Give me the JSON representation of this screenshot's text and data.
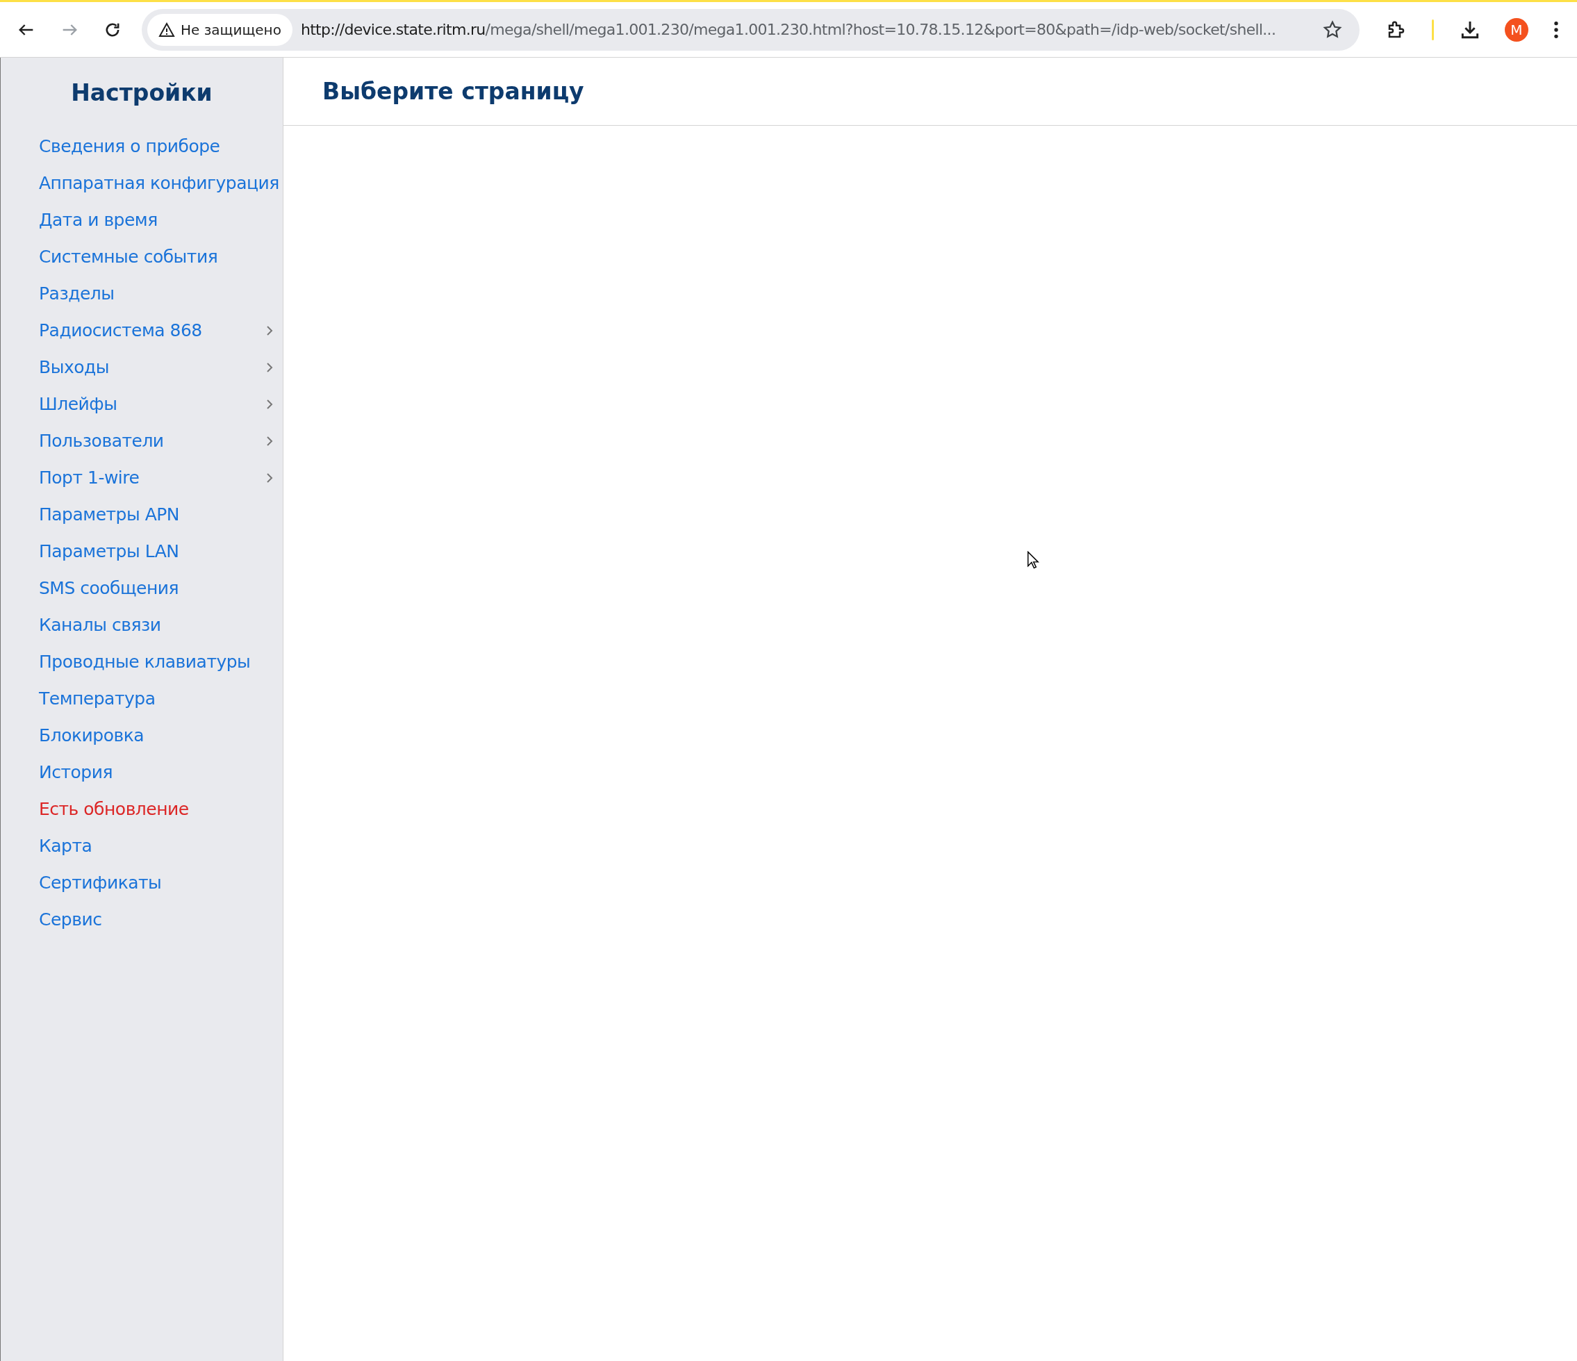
{
  "browser": {
    "security_label": "Не защищено",
    "url_host": "http://device.state.ritm.ru",
    "url_path": "/mega/shell/mega1.001.230/mega1.001.230.html?host=10.78.15.12&port=80&path=/idp-web/socket/shell...",
    "profile_initial": "M"
  },
  "sidebar": {
    "title": "Настройки",
    "items": [
      {
        "label": "Сведения о приборе",
        "has_submenu": false,
        "alert": false
      },
      {
        "label": "Аппаратная конфигурация",
        "has_submenu": false,
        "alert": false
      },
      {
        "label": "Дата и время",
        "has_submenu": false,
        "alert": false
      },
      {
        "label": "Системные события",
        "has_submenu": false,
        "alert": false
      },
      {
        "label": "Разделы",
        "has_submenu": false,
        "alert": false
      },
      {
        "label": "Радиосистема 868",
        "has_submenu": true,
        "alert": false
      },
      {
        "label": "Выходы",
        "has_submenu": true,
        "alert": false
      },
      {
        "label": "Шлейфы",
        "has_submenu": true,
        "alert": false
      },
      {
        "label": "Пользователи",
        "has_submenu": true,
        "alert": false
      },
      {
        "label": "Порт 1-wire",
        "has_submenu": true,
        "alert": false
      },
      {
        "label": "Параметры APN",
        "has_submenu": false,
        "alert": false
      },
      {
        "label": "Параметры LAN",
        "has_submenu": false,
        "alert": false
      },
      {
        "label": "SMS сообщения",
        "has_submenu": false,
        "alert": false
      },
      {
        "label": "Каналы связи",
        "has_submenu": false,
        "alert": false
      },
      {
        "label": "Проводные клавиатуры",
        "has_submenu": false,
        "alert": false
      },
      {
        "label": "Температура",
        "has_submenu": false,
        "alert": false
      },
      {
        "label": "Блокировка",
        "has_submenu": false,
        "alert": false
      },
      {
        "label": "История",
        "has_submenu": false,
        "alert": false
      },
      {
        "label": "Есть обновление",
        "has_submenu": false,
        "alert": true
      },
      {
        "label": "Карта",
        "has_submenu": false,
        "alert": false
      },
      {
        "label": "Сертификаты",
        "has_submenu": false,
        "alert": false
      },
      {
        "label": "Сервис",
        "has_submenu": false,
        "alert": false
      }
    ]
  },
  "content": {
    "title": "Выберите страницу"
  }
}
